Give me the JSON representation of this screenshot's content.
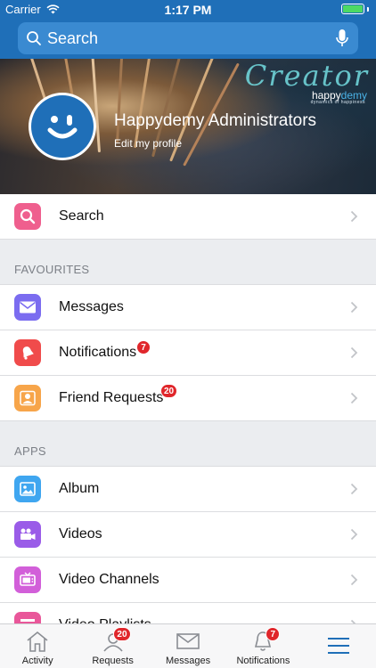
{
  "status_bar": {
    "carrier": "Carrier",
    "time": "1:17 PM"
  },
  "search": {
    "placeholder": "Search"
  },
  "cover": {
    "creator_text": "Creator",
    "logo_part1": "happy",
    "logo_part2": "demy",
    "tagline": "dynamics of happiness"
  },
  "profile": {
    "name": "Happydemy Administrators",
    "edit_link": "Edit my profile"
  },
  "menu": {
    "search_label": "Search",
    "favourites_header": "FAVOURITES",
    "favourites": [
      {
        "label": "Messages",
        "icon": "envelope-icon",
        "color": "#7b6cf0"
      },
      {
        "label": "Notifications",
        "icon": "bell-icon",
        "color": "#f04b4b",
        "badge": "7"
      },
      {
        "label": "Friend Requests",
        "icon": "person-icon",
        "color": "#f7a54a",
        "badge": "20"
      }
    ],
    "apps_header": "APPS",
    "apps": [
      {
        "label": "Album",
        "icon": "photo-icon",
        "color": "#3fa6f0"
      },
      {
        "label": "Videos",
        "icon": "video-camera-icon",
        "color": "#9a5ce8"
      },
      {
        "label": "Video Channels",
        "icon": "tv-icon",
        "color": "#d25fd9"
      },
      {
        "label": "Video Playlists",
        "icon": "playlist-icon",
        "color": "#e9579a"
      }
    ]
  },
  "tabbar": {
    "activity": "Activity",
    "requests": "Requests",
    "requests_badge": "20",
    "messages": "Messages",
    "notifications": "Notifications",
    "notifications_badge": "7"
  },
  "colors": {
    "brand": "#1f6fb8",
    "badge": "#e0262b",
    "active_tab": "#1f6fb8"
  }
}
